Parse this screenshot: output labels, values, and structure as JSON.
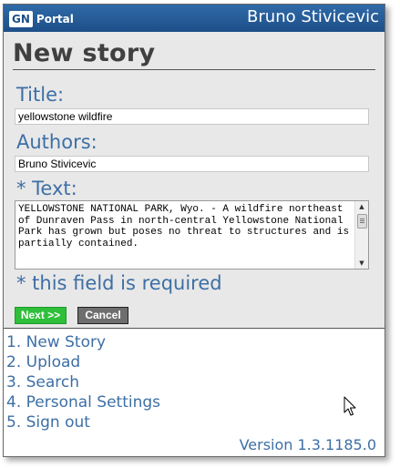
{
  "header": {
    "logo_badge": "GN",
    "logo_text": "Portal",
    "user_name": "Bruno Stivicevic"
  },
  "page": {
    "title": "New story"
  },
  "form": {
    "title_label": "Title:",
    "title_value": "yellowstone wildfire",
    "authors_label": "Authors:",
    "authors_value": "Bruno Stivicevic",
    "text_label": "*  Text:",
    "text_value": "YELLOWSTONE NATIONAL PARK, Wyo. - A wildfire northeast of Dunraven Pass in north-central Yellowstone National Park has grown but poses no threat to structures and is partially contained.",
    "required_note": "* this field is required",
    "next_label": "Next >>",
    "cancel_label": "Cancel"
  },
  "nav": {
    "items": [
      {
        "label": "1. New Story"
      },
      {
        "label": "2. Upload"
      },
      {
        "label": "3. Search"
      },
      {
        "label": "4. Personal Settings"
      },
      {
        "label": "5. Sign out"
      }
    ]
  },
  "footer": {
    "version": "Version 1.3.1185.0"
  },
  "icons": {
    "logo": "gn-portal-logo-icon",
    "cursor": "mouse-pointer-icon"
  },
  "colors": {
    "header_bg": "#1d4f88",
    "accent_blue": "#3d6fa5",
    "next_green": "#2fbf3a",
    "cancel_gray": "#6e6e6e",
    "content_bg": "#e8e8e8"
  }
}
